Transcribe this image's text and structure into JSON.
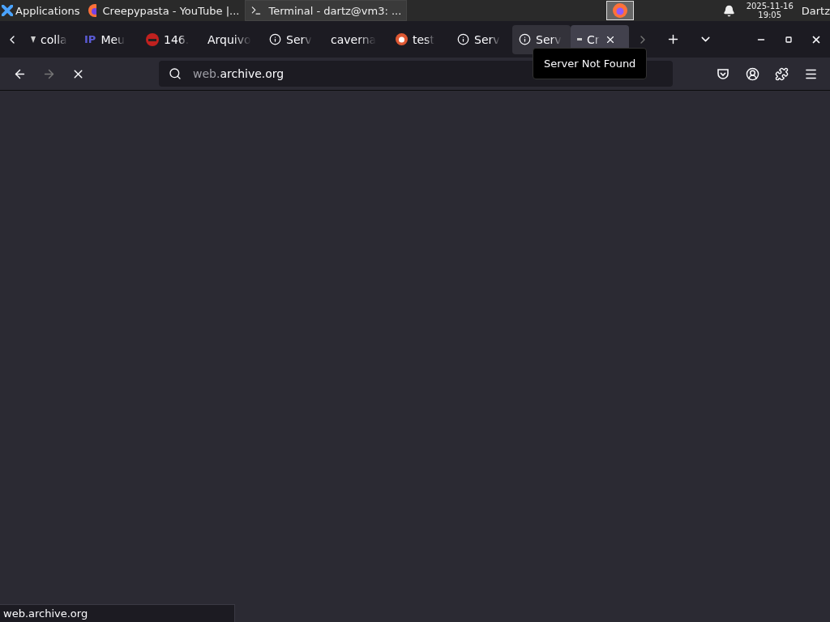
{
  "taskbar": {
    "menu": "Applications",
    "tasks": [
      {
        "title": "Creepypasta - YouTube |...",
        "kind": "browser",
        "selected": false
      },
      {
        "title": "Terminal - dartz@vm3: ...",
        "kind": "terminal",
        "selected": true
      }
    ],
    "date": "2025-11-16",
    "time": "19:05",
    "user": "Dartz"
  },
  "tabs": [
    {
      "label": "colla",
      "kind": "mark",
      "selected": false,
      "hovered": false
    },
    {
      "label": "Meu",
      "kind": "badge",
      "badge": "IP",
      "selected": false,
      "hovered": false
    },
    {
      "label": "146.",
      "kind": "blocked",
      "selected": false,
      "hovered": false
    },
    {
      "label": "Arquivo",
      "kind": "plain",
      "selected": false,
      "hovered": false
    },
    {
      "label": "Serv",
      "kind": "info",
      "selected": false,
      "hovered": false
    },
    {
      "label": "caverna",
      "kind": "plain",
      "selected": false,
      "hovered": false
    },
    {
      "label": "test",
      "kind": "duck",
      "selected": false,
      "hovered": false
    },
    {
      "label": "Serv",
      "kind": "info",
      "selected": false,
      "hovered": false
    },
    {
      "label": "Serv",
      "kind": "info",
      "selected": false,
      "hovered": true
    },
    {
      "label": "Cr",
      "kind": "loading",
      "selected": true,
      "hovered": false
    }
  ],
  "tooltip": "Server Not Found",
  "address": {
    "prefix": "web.",
    "domain": "archive.org"
  },
  "status": "web.archive.org"
}
